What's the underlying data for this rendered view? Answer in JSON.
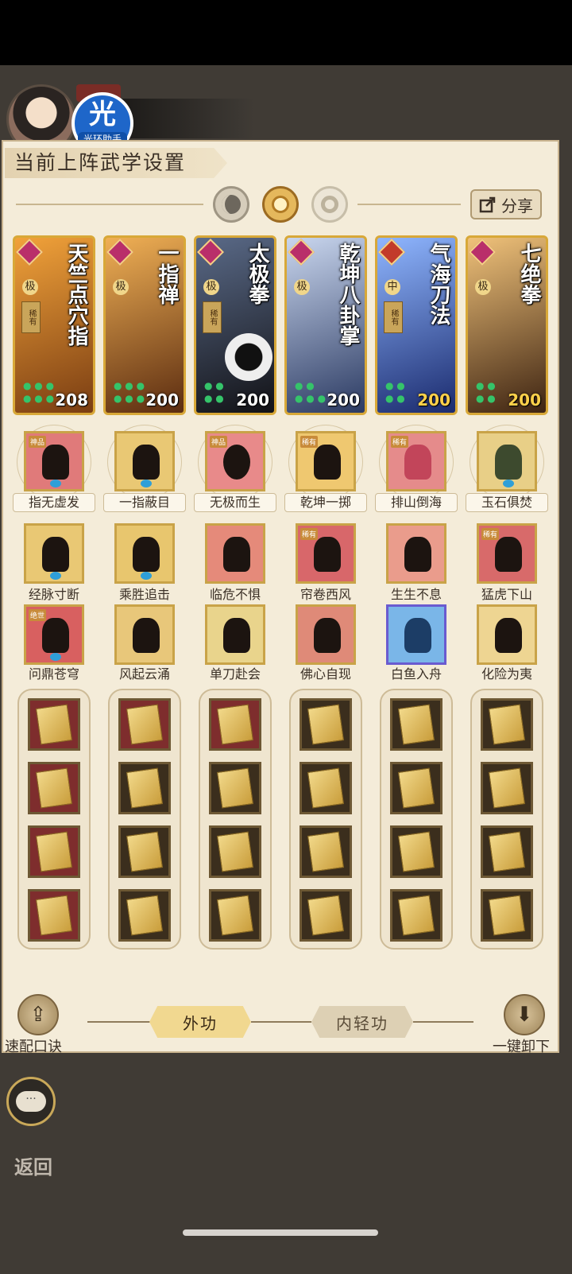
{
  "header": {
    "logo_text": "光",
    "logo_caption": "光环助手"
  },
  "panel": {
    "title": "当前上阵武学设置",
    "share_label": "分享",
    "share_icon": "share-icon",
    "modes": [
      "moon-icon",
      "sun-icon",
      "ring-icon"
    ]
  },
  "cards": [
    {
      "name": "天竺点穴指",
      "grade": "极",
      "rarity": "稀有",
      "power": "208",
      "bg": "#b3641c"
    },
    {
      "name": "一指禅",
      "grade": "极",
      "rarity": "",
      "power": "200",
      "bg": "#9b5a1b"
    },
    {
      "name": "太极拳",
      "grade": "极",
      "rarity": "稀有",
      "power": "200",
      "bg": "#2a2a30"
    },
    {
      "name": "乾坤八卦掌",
      "grade": "极",
      "rarity": "",
      "power": "200",
      "bg": "#35466a"
    },
    {
      "name": "气海刀法",
      "grade": "中",
      "rarity": "稀有",
      "power": "200",
      "bg": "#2b3f86"
    },
    {
      "name": "七绝拳",
      "grade": "极",
      "rarity": "",
      "power": "200",
      "bg": "#5d3b22"
    }
  ],
  "skills_row1": [
    {
      "label": "指无虚发",
      "tag": "神品",
      "bg": "#e07a7a"
    },
    {
      "label": "一指蔽目",
      "tag": "",
      "bg": "#e9c874"
    },
    {
      "label": "无极而生",
      "tag": "神品",
      "bg": "#e88a8a"
    },
    {
      "label": "乾坤一掷",
      "tag": "稀有",
      "bg": "#efc870"
    },
    {
      "label": "排山倒海",
      "tag": "稀有",
      "bg": "#e58b8b"
    },
    {
      "label": "玉石俱焚",
      "tag": "",
      "bg": "#e8cf87"
    }
  ],
  "skills_row2": [
    {
      "label": "经脉寸断",
      "tag": "",
      "bg": "#e9c874"
    },
    {
      "label": "乘胜追击",
      "tag": "",
      "bg": "#e8c66e"
    },
    {
      "label": "临危不惧",
      "tag": "",
      "bg": "#e58a7a"
    },
    {
      "label": "帘卷西风",
      "tag": "稀有",
      "bg": "#d8676a"
    },
    {
      "label": "生生不息",
      "tag": "",
      "bg": "#ea9c8c"
    },
    {
      "label": "猛虎下山",
      "tag": "稀有",
      "bg": "#d86a6a"
    }
  ],
  "skills_row3": [
    {
      "label": "问鼎苍穹",
      "tag": "绝世",
      "bg": "#d86060"
    },
    {
      "label": "风起云涌",
      "tag": "",
      "bg": "#e8c77a"
    },
    {
      "label": "单刀赴会",
      "tag": "",
      "bg": "#e9d48c"
    },
    {
      "label": "佛心自现",
      "tag": "",
      "bg": "#df8a78"
    },
    {
      "label": "白鱼入舟",
      "tag": "",
      "bg": "#7ab6e8"
    },
    {
      "label": "化险为夷",
      "tag": "",
      "bg": "#eed592"
    }
  ],
  "bottom": {
    "quick_label": "速配口诀",
    "unload_label": "一键卸下",
    "tab_outer": "外功",
    "tab_inner": "内轻功",
    "quick_icon": "upload-icon",
    "unload_icon": "download-icon"
  },
  "back_label": "返回"
}
